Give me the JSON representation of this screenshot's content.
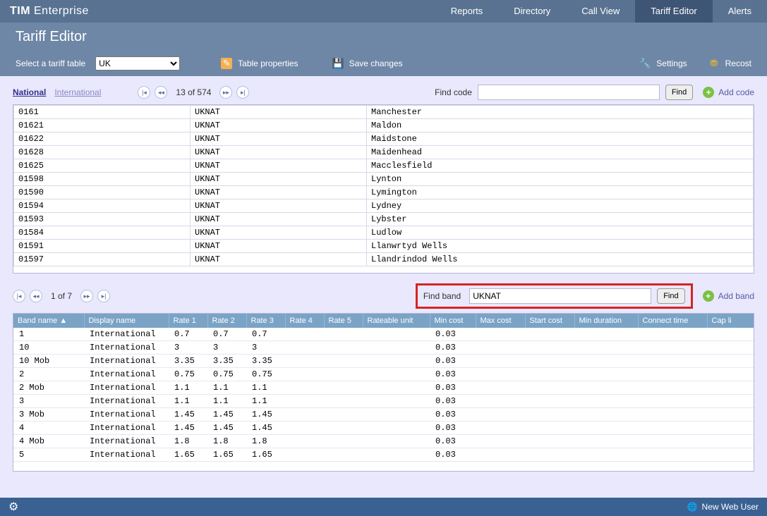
{
  "brand_bold": "TIM",
  "brand_light": "Enterprise",
  "nav": {
    "reports": "Reports",
    "directory": "Directory",
    "callview": "Call View",
    "tariff": "Tariff Editor",
    "alerts": "Alerts"
  },
  "page_title": "Tariff Editor",
  "toolbar": {
    "select_label": "Select a tariff table",
    "select_value": "UK",
    "table_props": "Table properties",
    "save": "Save changes",
    "settings": "Settings",
    "recost": "Recost"
  },
  "tabs": {
    "national": "National",
    "international": "International"
  },
  "codes_pager": "13 of 574",
  "find_code_label": "Find code",
  "find_code_btn": "Find",
  "add_code": "Add code",
  "codes": [
    {
      "code": "0161",
      "band": "UKNAT",
      "loc": "Manchester"
    },
    {
      "code": "01621",
      "band": "UKNAT",
      "loc": "Maldon"
    },
    {
      "code": "01622",
      "band": "UKNAT",
      "loc": "Maidstone"
    },
    {
      "code": "01628",
      "band": "UKNAT",
      "loc": "Maidenhead"
    },
    {
      "code": "01625",
      "band": "UKNAT",
      "loc": "Macclesfield"
    },
    {
      "code": "01598",
      "band": "UKNAT",
      "loc": "Lynton"
    },
    {
      "code": "01590",
      "band": "UKNAT",
      "loc": "Lymington"
    },
    {
      "code": "01594",
      "band": "UKNAT",
      "loc": "Lydney"
    },
    {
      "code": "01593",
      "band": "UKNAT",
      "loc": "Lybster"
    },
    {
      "code": "01584",
      "band": "UKNAT",
      "loc": "Ludlow"
    },
    {
      "code": "01591",
      "band": "UKNAT",
      "loc": "Llanwrtyd Wells"
    },
    {
      "code": "01597",
      "band": "UKNAT",
      "loc": "Llandrindod Wells"
    }
  ],
  "bands_pager": "1 of 7",
  "find_band_label": "Find band",
  "find_band_value": "UKNAT",
  "find_band_btn": "Find",
  "add_band": "Add band",
  "band_headers": {
    "name": "Band name ▲",
    "display": "Display name",
    "r1": "Rate 1",
    "r2": "Rate 2",
    "r3": "Rate 3",
    "r4": "Rate 4",
    "r5": "Rate 5",
    "ru": "Rateable unit",
    "min": "Min cost",
    "max": "Max cost",
    "start": "Start cost",
    "mindur": "Min duration",
    "conn": "Connect time",
    "cap": "Cap li"
  },
  "bands": [
    {
      "name": "1",
      "disp": "International",
      "r1": "0.7",
      "r2": "0.7",
      "r3": "0.7",
      "min": "0.03"
    },
    {
      "name": "10",
      "disp": "International",
      "r1": "3",
      "r2": "3",
      "r3": "3",
      "min": "0.03"
    },
    {
      "name": "10 Mob",
      "disp": "International",
      "r1": "3.35",
      "r2": "3.35",
      "r3": "3.35",
      "min": "0.03"
    },
    {
      "name": "2",
      "disp": "International",
      "r1": "0.75",
      "r2": "0.75",
      "r3": "0.75",
      "min": "0.03"
    },
    {
      "name": "2 Mob",
      "disp": "International",
      "r1": "1.1",
      "r2": "1.1",
      "r3": "1.1",
      "min": "0.03"
    },
    {
      "name": "3",
      "disp": "International",
      "r1": "1.1",
      "r2": "1.1",
      "r3": "1.1",
      "min": "0.03"
    },
    {
      "name": "3 Mob",
      "disp": "International",
      "r1": "1.45",
      "r2": "1.45",
      "r3": "1.45",
      "min": "0.03"
    },
    {
      "name": "4",
      "disp": "International",
      "r1": "1.45",
      "r2": "1.45",
      "r3": "1.45",
      "min": "0.03"
    },
    {
      "name": "4 Mob",
      "disp": "International",
      "r1": "1.8",
      "r2": "1.8",
      "r3": "1.8",
      "min": "0.03"
    },
    {
      "name": "5",
      "disp": "International",
      "r1": "1.65",
      "r2": "1.65",
      "r3": "1.65",
      "min": "0.03"
    }
  ],
  "footer_user": "New Web User"
}
